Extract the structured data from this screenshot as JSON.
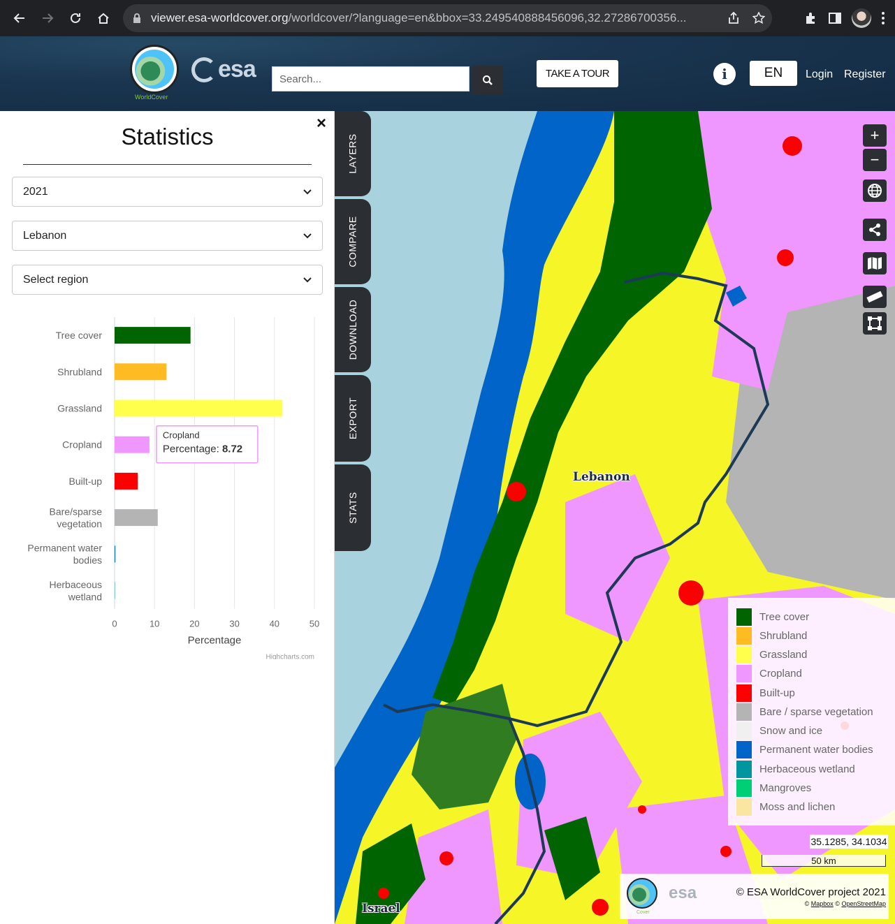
{
  "browser": {
    "url_host": "viewer.esa-worldcover.org",
    "url_rest": "/worldcover/?language=en&bbox=33.249540888456096,32.27286700356..."
  },
  "header": {
    "logo_label": "WorldCover",
    "esa_label": "esa",
    "search_placeholder": "Search...",
    "tour_label": "TAKE A TOUR",
    "info_label": "i",
    "language": "EN",
    "login_label": "Login",
    "register_label": "Register"
  },
  "panel": {
    "title": "Statistics",
    "close_label": "×",
    "year": "2021",
    "country": "Lebanon",
    "region": "Select region"
  },
  "chart_data": {
    "type": "bar",
    "orientation": "horizontal",
    "categories": [
      "Tree cover",
      "Shrubland",
      "Grassland",
      "Cropland",
      "Built-up",
      "Bare/sparse vegetation",
      "Permanent water bodies",
      "Herbaceous wetland"
    ],
    "category_lines": [
      [
        "Tree cover"
      ],
      [
        "Shrubland"
      ],
      [
        "Grassland"
      ],
      [
        "Cropland"
      ],
      [
        "Built-up"
      ],
      [
        "Bare/sparse",
        "vegetation"
      ],
      [
        "Permanent water",
        "bodies"
      ],
      [
        "Herbaceous",
        "wetland"
      ]
    ],
    "values": [
      19,
      13,
      42,
      8.72,
      5.8,
      10.8,
      0.2,
      0.02
    ],
    "colors": [
      "#006400",
      "#ffbb22",
      "#ffff4c",
      "#f096ff",
      "#fa0000",
      "#b4b4b4",
      "#0064c8",
      "#0096a0"
    ],
    "xlabel": "Percentage",
    "xticks": [
      0,
      10,
      20,
      30,
      40,
      50
    ],
    "xlim": [
      0,
      50
    ],
    "credit": "Highcharts.com",
    "tooltip": {
      "category": "Cropland",
      "label": "Percentage:",
      "value": "8.72"
    }
  },
  "tabs": [
    "LAYERS",
    "COMPARE",
    "DOWNLOAD",
    "EXPORT",
    "STATS"
  ],
  "map": {
    "labels": {
      "lebanon": "Lebanon",
      "israel": "Israel"
    },
    "zoom_in": "+",
    "zoom_out": "−",
    "coords": "35.1285, 34.1034",
    "scale": "50 km",
    "attribution": "© ESA WorldCover project 2021",
    "attribution_mapbox": "Mapbox",
    "attribution_osm": "OpenStreetMap",
    "attribution_sep": "©",
    "attrib_logo_label": "Cover"
  },
  "legend": [
    {
      "label": "Tree cover",
      "color": "#006400"
    },
    {
      "label": "Shrubland",
      "color": "#ffbb22"
    },
    {
      "label": "Grassland",
      "color": "#ffff4c"
    },
    {
      "label": "Cropland",
      "color": "#f096ff"
    },
    {
      "label": "Built-up",
      "color": "#fa0000"
    },
    {
      "label": "Bare / sparse vegetation",
      "color": "#b4b4b4"
    },
    {
      "label": "Snow and ice",
      "color": "#f0f0f0"
    },
    {
      "label": "Permanent water bodies",
      "color": "#0064c8"
    },
    {
      "label": "Herbaceous wetland",
      "color": "#0096a0"
    },
    {
      "label": "Mangroves",
      "color": "#00cf75"
    },
    {
      "label": "Moss and lichen",
      "color": "#fae6a0"
    }
  ]
}
